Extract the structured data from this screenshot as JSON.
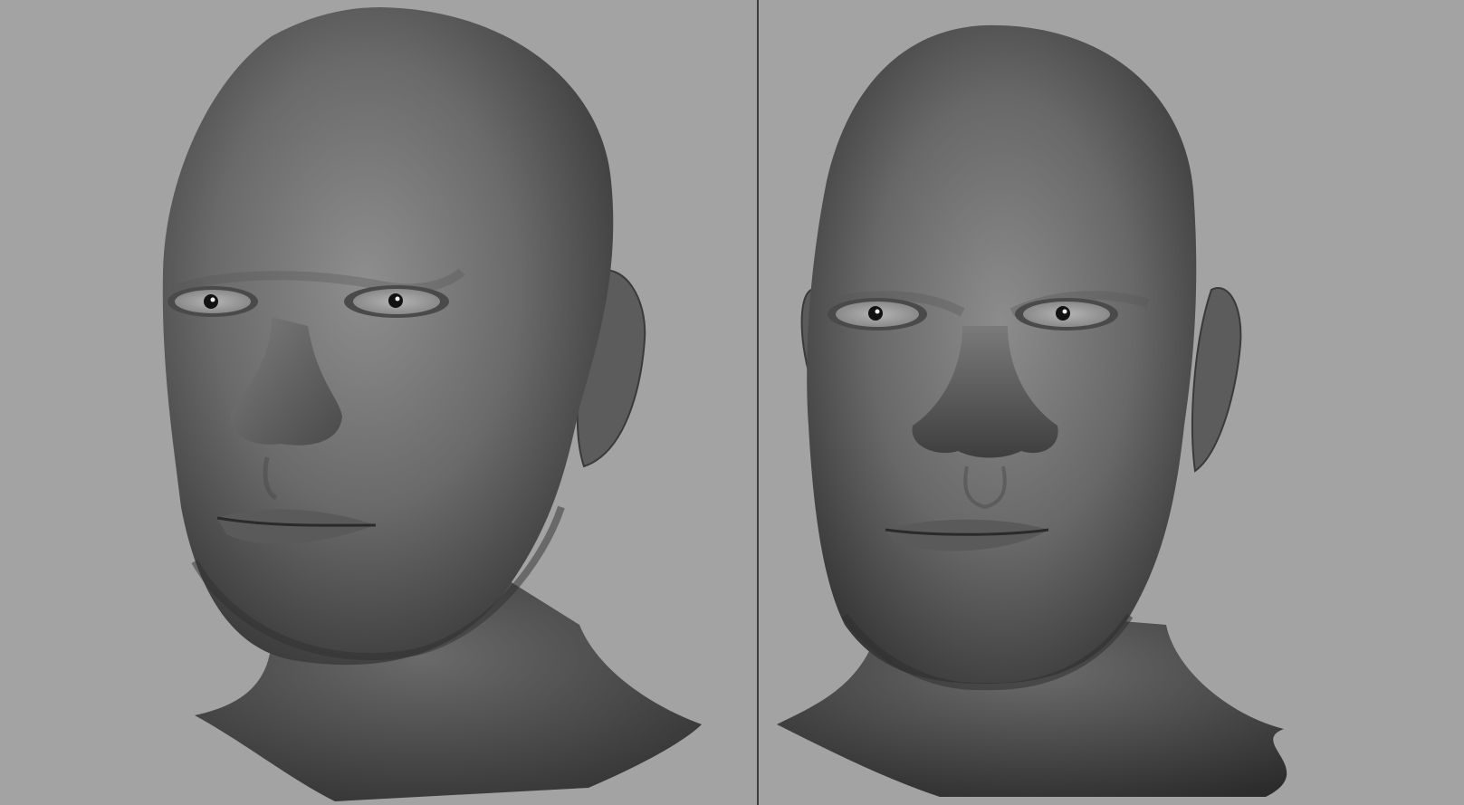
{
  "app": {
    "window_title": "",
    "colors": {
      "viewport_background": "#a3a3a3",
      "divider": "#3c3c3c",
      "model_base": "#6e6e6e",
      "model_dark": "#2f2f2f",
      "model_light": "#9a9a9a"
    }
  },
  "viewports": [
    {
      "name": "perspective-view",
      "model": "sculpted-male-head",
      "view_angle": "three-quarter-left"
    },
    {
      "name": "front-view",
      "model": "sculpted-male-head",
      "view_angle": "front"
    }
  ]
}
